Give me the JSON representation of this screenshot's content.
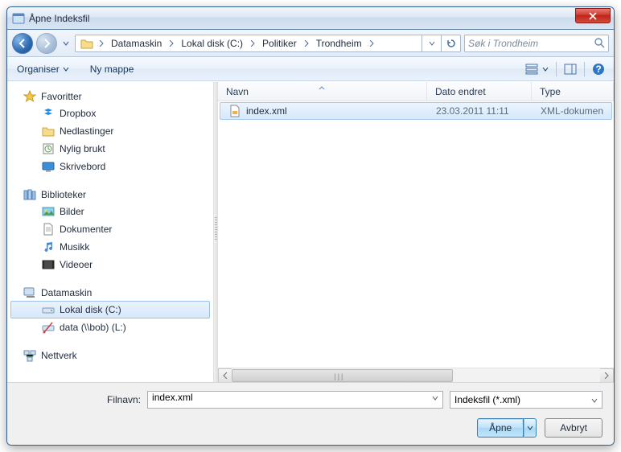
{
  "window": {
    "title": "Åpne Indeksfil"
  },
  "breadcrumbs": [
    "Datamaskin",
    "Lokal disk (C:)",
    "Politiker",
    "Trondheim"
  ],
  "search": {
    "placeholder": "Søk i Trondheim"
  },
  "toolbar": {
    "organize": "Organiser",
    "newfolder": "Ny mappe"
  },
  "nav": {
    "favorites": {
      "header": "Favoritter",
      "items": [
        "Dropbox",
        "Nedlastinger",
        "Nylig brukt",
        "Skrivebord"
      ]
    },
    "libraries": {
      "header": "Biblioteker",
      "items": [
        "Bilder",
        "Dokumenter",
        "Musikk",
        "Videoer"
      ]
    },
    "computer": {
      "header": "Datamaskin",
      "items": [
        "Lokal disk (C:)",
        "data (\\\\bob) (L:)"
      ],
      "selected": 0
    },
    "network": {
      "header": "Nettverk"
    }
  },
  "columns": {
    "name": "Navn",
    "date": "Dato endret",
    "type": "Type"
  },
  "files": [
    {
      "name": "index.xml",
      "date": "23.03.2011 11:11",
      "type": "XML-dokumen"
    }
  ],
  "bottom": {
    "filename_label": "Filnavn:",
    "filename_value": "index.xml",
    "filter": "Indeksfil (*.xml)",
    "open": "Åpne",
    "cancel": "Avbryt"
  }
}
